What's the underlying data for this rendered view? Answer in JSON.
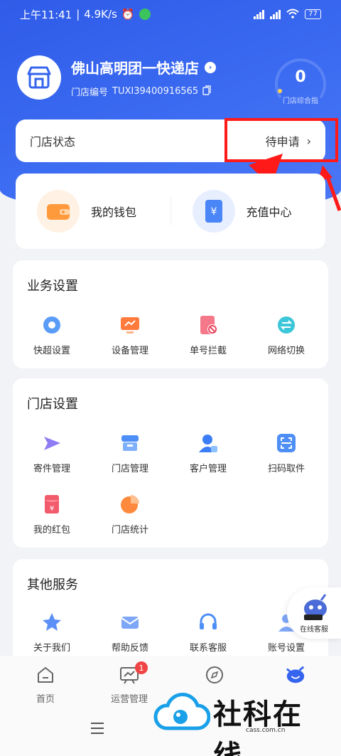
{
  "status_bar": {
    "time": "上午11:41",
    "speed": "4.9K/s",
    "battery": "77"
  },
  "store": {
    "name": "佛山高明团一快递店",
    "number_label": "门店编号",
    "number": "TUXI39400916565",
    "score": "0",
    "score_label": "门店综合指"
  },
  "store_status": {
    "label": "门店状态",
    "value": "待申请"
  },
  "quick": {
    "wallet": "我的钱包",
    "recharge": "充值中心"
  },
  "business": {
    "title": "业务设置",
    "items": [
      {
        "label": "快超设置",
        "icon": "gear-icon"
      },
      {
        "label": "设备管理",
        "icon": "monitor-icon"
      },
      {
        "label": "单号拦截",
        "icon": "block-icon"
      },
      {
        "label": "网络切换",
        "icon": "switch-icon"
      }
    ]
  },
  "store_settings": {
    "title": "门店设置",
    "items": [
      {
        "label": "寄件管理",
        "icon": "send-icon"
      },
      {
        "label": "门店管理",
        "icon": "store-icon"
      },
      {
        "label": "客户管理",
        "icon": "user-icon"
      },
      {
        "label": "扫码取件",
        "icon": "scan-icon"
      },
      {
        "label": "我的红包",
        "icon": "red-packet-icon"
      },
      {
        "label": "门店统计",
        "icon": "pie-chart-icon"
      }
    ]
  },
  "other": {
    "title": "其他服务",
    "items": [
      {
        "label": "关于我们",
        "icon": "star-icon"
      },
      {
        "label": "帮助反馈",
        "icon": "mail-icon"
      },
      {
        "label": "联系客服",
        "icon": "headset-icon"
      },
      {
        "label": "账号设置",
        "icon": "account-icon"
      }
    ]
  },
  "float_service": "在线客服",
  "tabs": [
    {
      "label": "首页"
    },
    {
      "label": "运营管理",
      "badge": "1"
    },
    {
      "label": ""
    },
    {
      "label": ""
    }
  ],
  "watermark": {
    "text": "社科在线",
    "url": "cass.com.cn"
  },
  "colors": {
    "brand": "#3564ee",
    "highlight": "#ff1a1a"
  }
}
